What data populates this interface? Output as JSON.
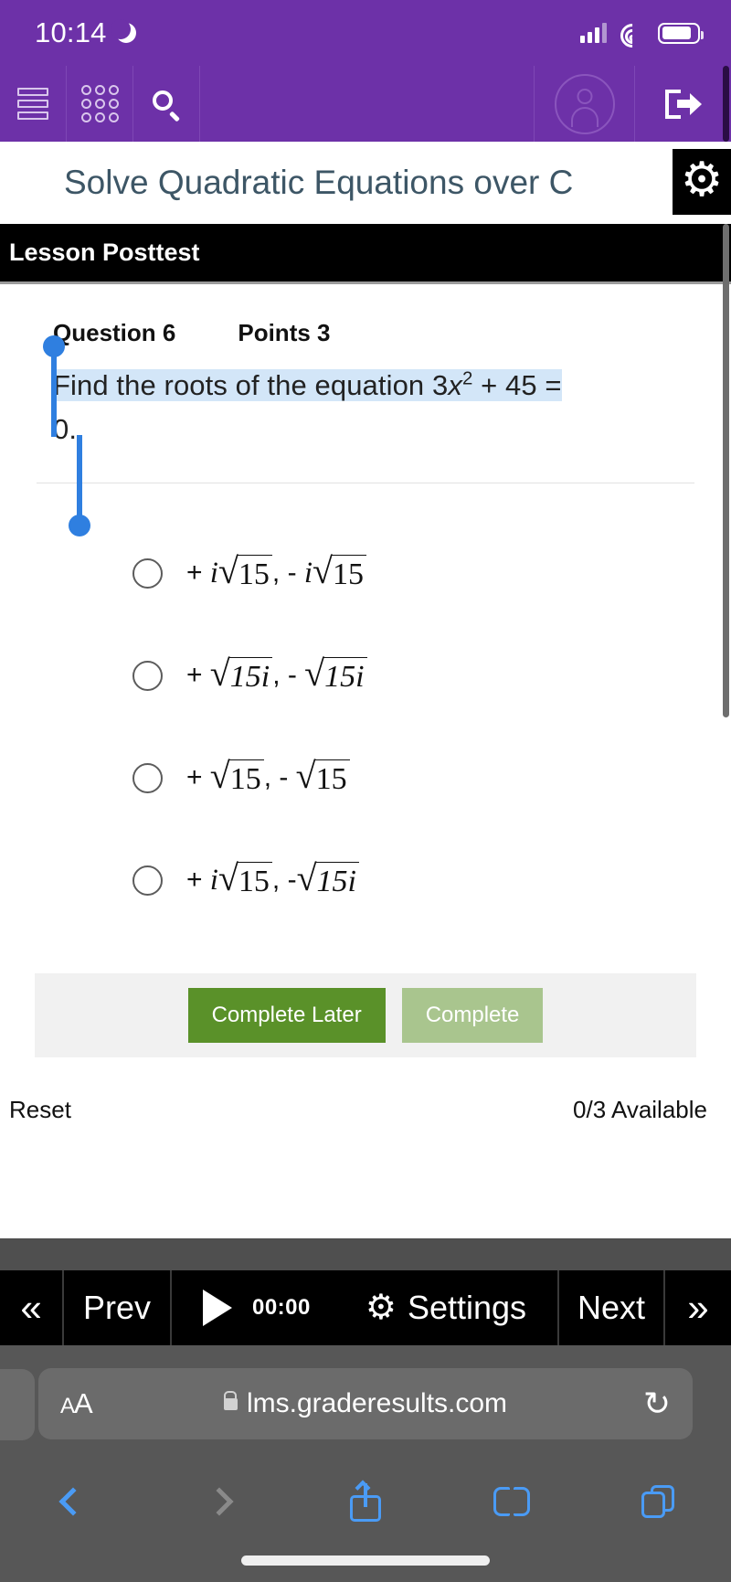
{
  "status_bar": {
    "time": "10:14",
    "moon_icon": "crescent-moon-icon",
    "signal_icon": "cellular-signal-icon",
    "wifi_icon": "wifi-icon",
    "battery_icon": "battery-icon"
  },
  "lms_nav": {
    "menu_icon": "hamburger-menu-icon",
    "apps_icon": "app-grid-icon",
    "search_icon": "search-icon",
    "avatar_icon": "user-avatar-icon",
    "logout_icon": "logout-icon"
  },
  "page": {
    "title": "Solve Quadratic Equations over C",
    "gear_icon": "gear-icon",
    "section_label": "Lesson Posttest"
  },
  "question": {
    "number_label": "Question 6",
    "points_label": "Points 3",
    "text_part1": "Find the roots of the equation 3",
    "text_var": "x",
    "text_exp": "2",
    "text_part2": " + 45 =",
    "text_line2": "0.",
    "selection_color": "#d3e6f8",
    "handle_color": "#2f7fe0"
  },
  "options": [
    {
      "id": "option-1",
      "sign1": "+",
      "coef1": "i",
      "rad1": "15",
      "sep": ", -",
      "coef2": "i",
      "rad2": "15",
      "selected": false
    },
    {
      "id": "option-2",
      "sign1": "+",
      "coef1": "",
      "rad1": "15i",
      "sep": ", -",
      "coef2": "",
      "rad2": "15i",
      "selected": false
    },
    {
      "id": "option-3",
      "sign1": "+",
      "coef1": "",
      "rad1": "15",
      "sep": ", -",
      "coef2": "",
      "rad2": "15",
      "selected": false
    },
    {
      "id": "option-4",
      "sign1": "+",
      "coef1": "i",
      "rad1": "15",
      "sep": ", -",
      "coef2": "",
      "rad2": "15i",
      "selected": false
    }
  ],
  "actions": {
    "complete_later_label": "Complete Later",
    "complete_label": "Complete",
    "complete_later_color": "#5a9129",
    "complete_color": "#a9c58e"
  },
  "footer_meta": {
    "reset_label": "Reset",
    "available_label": "0/3 Available"
  },
  "player_bar": {
    "first_icon": "«",
    "prev_label": "Prev",
    "play_icon": "play-icon",
    "time": "00:00",
    "settings_icon": "gear-icon",
    "settings_label": "Settings",
    "next_label": "Next",
    "last_icon": "»"
  },
  "safari": {
    "text_size_label": "A",
    "text_size_label_small": "A",
    "lock_icon": "lock-icon",
    "url": "lms.graderesults.com",
    "reload_icon": "↻",
    "back_icon": "chevron-left-icon",
    "forward_icon": "chevron-right-icon",
    "share_icon": "share-icon",
    "bookmarks_icon": "book-icon",
    "tabs_icon": "tabs-icon"
  },
  "colors": {
    "brand_purple": "#6d31a8",
    "title_text": "#3d5666",
    "accent_blue": "#4a9bf5"
  }
}
